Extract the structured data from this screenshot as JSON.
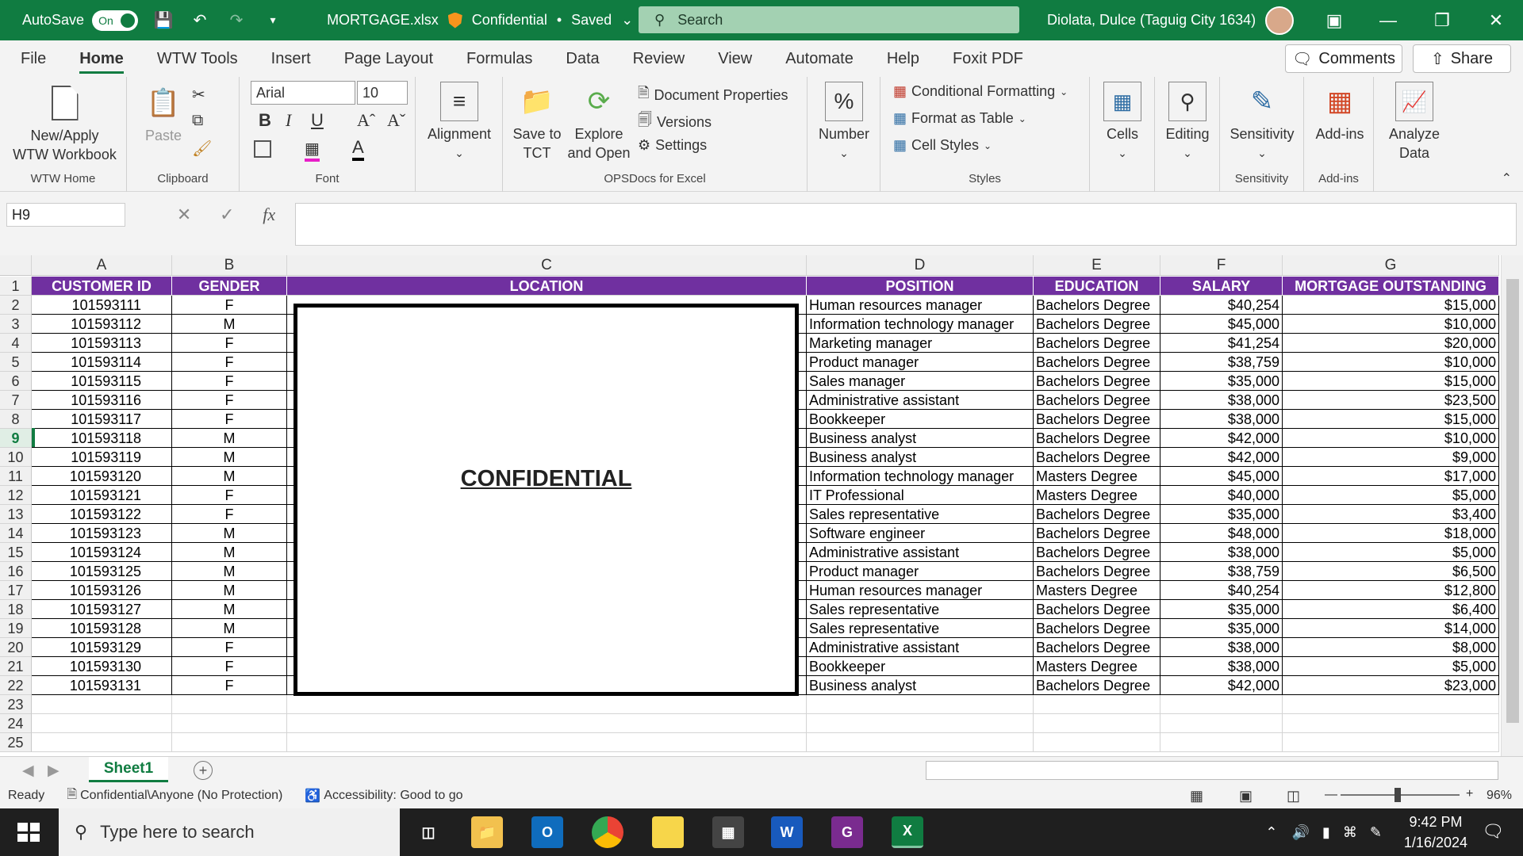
{
  "titlebar": {
    "autosave_label": "AutoSave",
    "autosave_state": "On",
    "filename": "MORTGAGE.xlsx",
    "sensitivity": "Confidential",
    "save_status": "Saved",
    "search_placeholder": "Search",
    "user_name": "Diolata, Dulce (Taguig City 1634)"
  },
  "menu": {
    "tabs": [
      "File",
      "Home",
      "WTW Tools",
      "Insert",
      "Page Layout",
      "Formulas",
      "Data",
      "Review",
      "View",
      "Automate",
      "Help",
      "Foxit PDF"
    ],
    "active": "Home",
    "comments": "Comments",
    "share": "Share"
  },
  "ribbon": {
    "wtw_home": {
      "button1": "New/Apply",
      "button2": "WTW Workbook",
      "label": "WTW Home"
    },
    "clipboard": {
      "paste": "Paste",
      "label": "Clipboard"
    },
    "font": {
      "family": "Arial",
      "size": "10",
      "bold": "B",
      "italic": "I",
      "underline": "U",
      "label": "Font"
    },
    "alignment": {
      "label": "Alignment"
    },
    "opsdocs": {
      "save_to": "Save to",
      "tct": "TCT",
      "explore": "Explore",
      "and_open": "and Open",
      "doc_props": "Document Properties",
      "versions": "Versions",
      "settings": "Settings",
      "label": "OPSDocs for Excel"
    },
    "number": {
      "label": "Number"
    },
    "styles": {
      "conditional": "Conditional Formatting",
      "format_table": "Format as Table",
      "cell_styles": "Cell Styles",
      "label": "Styles"
    },
    "cells": {
      "label": "Cells"
    },
    "editing": {
      "label": "Editing"
    },
    "sensitivity": {
      "button": "Sensitivity",
      "label": "Sensitivity"
    },
    "addins": {
      "button": "Add-ins",
      "label": "Add-ins"
    },
    "analyze": {
      "line1": "Analyze",
      "line2": "Data"
    }
  },
  "formula_bar": {
    "name_box": "H9",
    "fx": "fx",
    "formula": ""
  },
  "grid": {
    "columns": [
      "A",
      "B",
      "C",
      "D",
      "E",
      "F",
      "G"
    ],
    "headers": [
      "CUSTOMER ID",
      "GENDER",
      "LOCATION",
      "POSITION",
      "EDUCATION",
      "SALARY",
      "MORTGAGE OUTSTANDING"
    ],
    "rows": [
      [
        "101593111",
        "F",
        "Human resources manager",
        "Bachelors Degree",
        "$40,254",
        "$15,000"
      ],
      [
        "101593112",
        "M",
        "Information technology manager",
        "Bachelors Degree",
        "$45,000",
        "$10,000"
      ],
      [
        "101593113",
        "F",
        "Marketing manager",
        "Bachelors Degree",
        "$41,254",
        "$20,000"
      ],
      [
        "101593114",
        "F",
        "Product manager",
        "Bachelors Degree",
        "$38,759",
        "$10,000"
      ],
      [
        "101593115",
        "F",
        "Sales manager",
        "Bachelors Degree",
        "$35,000",
        "$15,000"
      ],
      [
        "101593116",
        "F",
        "Administrative assistant",
        "Bachelors Degree",
        "$38,000",
        "$23,500"
      ],
      [
        "101593117",
        "F",
        "Bookkeeper",
        "Bachelors Degree",
        "$38,000",
        "$15,000"
      ],
      [
        "101593118",
        "M",
        "Business analyst",
        "Bachelors Degree",
        "$42,000",
        "$10,000"
      ],
      [
        "101593119",
        "M",
        "Business analyst",
        "Bachelors Degree",
        "$42,000",
        "$9,000"
      ],
      [
        "101593120",
        "M",
        "Information technology manager",
        "Masters Degree",
        "$45,000",
        "$17,000"
      ],
      [
        "101593121",
        "F",
        "IT Professional",
        "Masters Degree",
        "$40,000",
        "$5,000"
      ],
      [
        "101593122",
        "F",
        "Sales representative",
        "Bachelors Degree",
        "$35,000",
        "$3,400"
      ],
      [
        "101593123",
        "M",
        "Software engineer",
        "Bachelors Degree",
        "$48,000",
        "$18,000"
      ],
      [
        "101593124",
        "M",
        "Administrative assistant",
        "Bachelors Degree",
        "$38,000",
        "$5,000"
      ],
      [
        "101593125",
        "M",
        "Product manager",
        "Bachelors Degree",
        "$38,759",
        "$6,500"
      ],
      [
        "101593126",
        "M",
        "Human resources manager",
        "Masters Degree",
        "$40,254",
        "$12,800"
      ],
      [
        "101593127",
        "M",
        "Sales representative",
        "Bachelors Degree",
        "$35,000",
        "$6,400"
      ],
      [
        "101593128",
        "M",
        "Sales representative",
        "Bachelors Degree",
        "$35,000",
        "$14,000"
      ],
      [
        "101593129",
        "F",
        "Administrative assistant",
        "Bachelors Degree",
        "$38,000",
        "$8,000"
      ],
      [
        "101593130",
        "F",
        "Bookkeeper",
        "Masters Degree",
        "$38,000",
        "$5,000"
      ],
      [
        "101593131",
        "F",
        "Business analyst",
        "Bachelors Degree",
        "$42,000",
        "$23,000"
      ]
    ],
    "row_numbers": [
      "1",
      "2",
      "3",
      "4",
      "5",
      "6",
      "7",
      "8",
      "9",
      "10",
      "11",
      "12",
      "13",
      "14",
      "15",
      "16",
      "17",
      "18",
      "19",
      "20",
      "21",
      "22",
      "23",
      "24",
      "25"
    ],
    "selected_row": "9",
    "confidential_overlay": "CONFIDENTIAL"
  },
  "sheets": {
    "tabs": [
      "Sheet1"
    ],
    "active": "Sheet1"
  },
  "status": {
    "ready": "Ready",
    "protection": "Confidential\\Anyone (No Protection)",
    "accessibility": "Accessibility: Good to go",
    "zoom": "96%"
  },
  "taskbar": {
    "search_placeholder": "Type here to search",
    "time": "9:42 PM",
    "date": "1/16/2024"
  },
  "colors": {
    "excel_green": "#107c41",
    "header_purple": "#7030a0"
  }
}
